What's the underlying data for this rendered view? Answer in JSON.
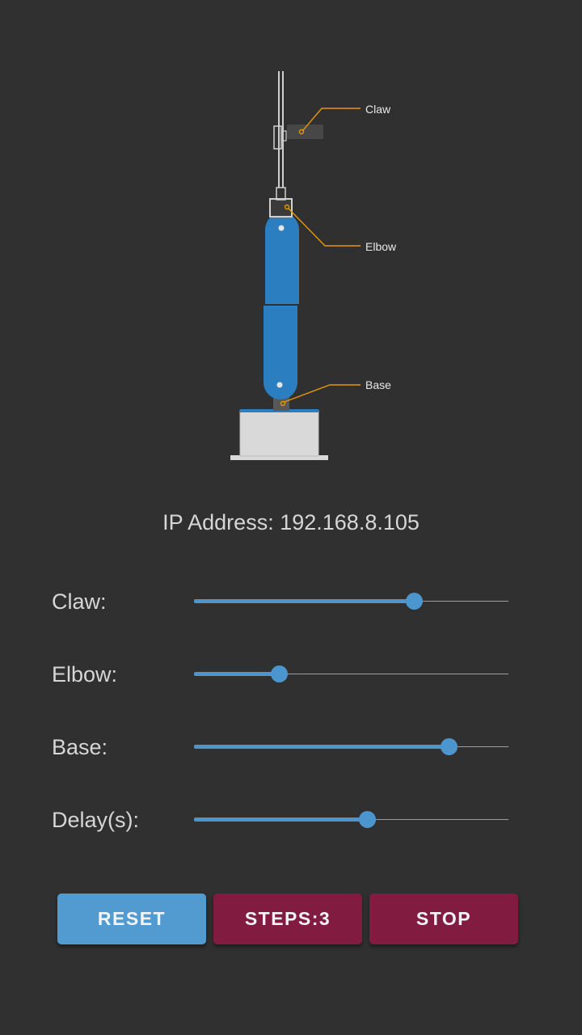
{
  "diagram": {
    "callouts": {
      "claw": "Claw",
      "elbow": "Elbow",
      "base": "Base"
    },
    "colors": {
      "arm_blue": "#2b7fc1",
      "callout_orange": "#e8960a",
      "base_grey": "#d9d9d9"
    }
  },
  "status": {
    "ip_label": "IP Address:",
    "ip_value": "192.168.8.105"
  },
  "controls": [
    {
      "label": "Claw:",
      "value": 0.7
    },
    {
      "label": "Elbow:",
      "value": 0.27
    },
    {
      "label": "Base:",
      "value": 0.81
    },
    {
      "label": "Delay(s):",
      "value": 0.55
    }
  ],
  "buttons": {
    "reset": "RESET",
    "steps": "STEPS:3",
    "stop": "STOP"
  },
  "theme": {
    "background": "#303030",
    "accent": "#4b96cf",
    "danger": "#821b40"
  }
}
